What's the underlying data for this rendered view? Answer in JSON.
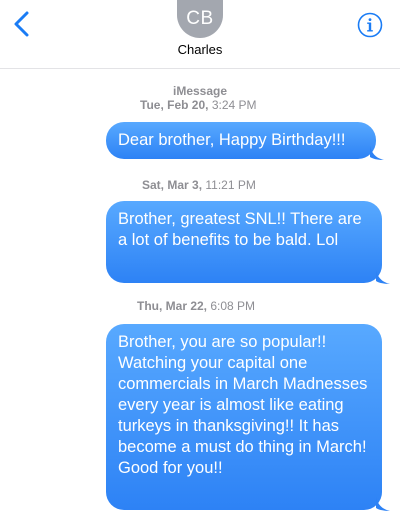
{
  "header": {
    "avatar_initials": "CB",
    "contact_name": "Charles"
  },
  "thread": {
    "service": "iMessage",
    "messages": [
      {
        "day": "Tue, Feb 20,",
        "time": "3:24 PM",
        "text": "Dear brother, Happy Birthday!!!"
      },
      {
        "day": "Sat, Mar 3,",
        "time": "11:21 PM",
        "text": "Brother, greatest SNL!! There are a lot of benefits to be bald. Lol"
      },
      {
        "day": "Thu, Mar 22,",
        "time": "6:08 PM",
        "text": "Brother, you are so popular!! Watching your capital one commercials in March Madnesses every year  is almost like eating turkeys in thanksgiving!! It has become a must do thing in March! Good for you!!"
      }
    ]
  },
  "colors": {
    "accent": "#1a7cf5",
    "bubble_top": "#58a9ff",
    "bubble_bottom": "#2d82f5",
    "avatar_bg": "#a3a7af",
    "meta_text": "#8e8e93"
  },
  "icons": [
    "chevron-left-icon",
    "info-icon"
  ]
}
